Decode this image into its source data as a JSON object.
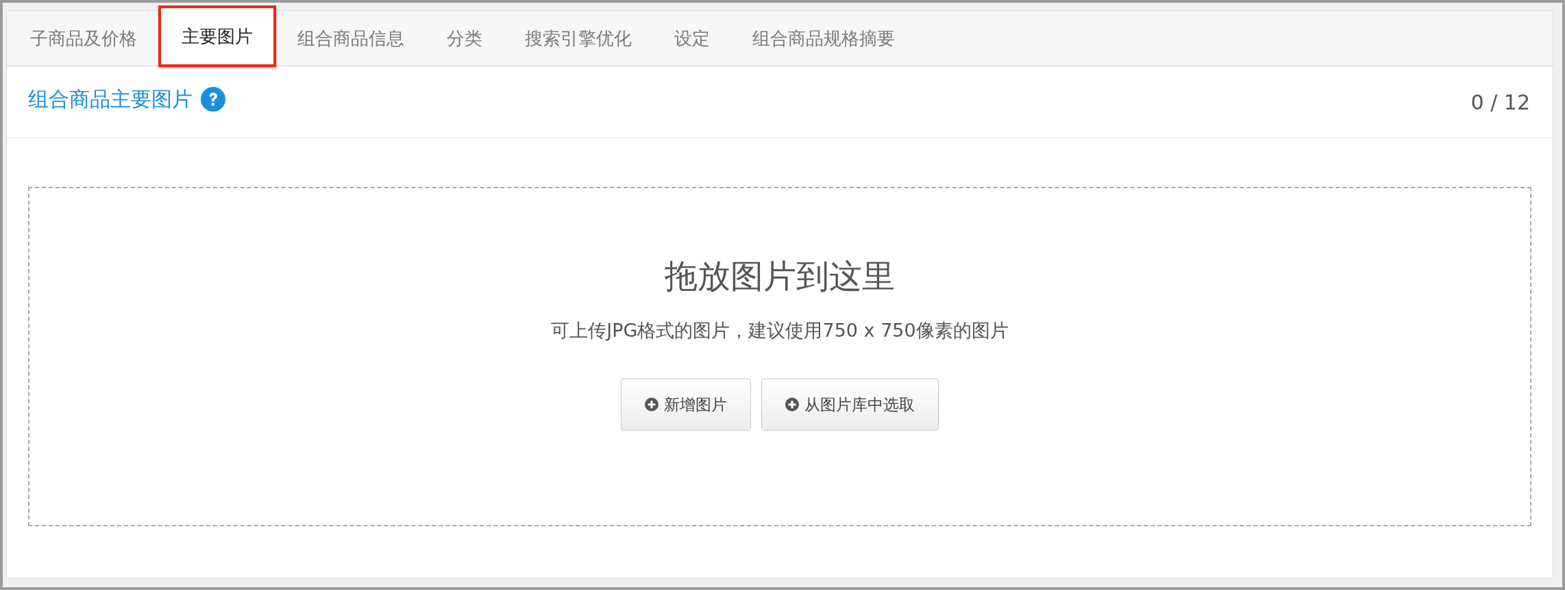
{
  "tabs": [
    {
      "label": "子商品及价格",
      "selected": false
    },
    {
      "label": "主要图片",
      "selected": true
    },
    {
      "label": "组合商品信息",
      "selected": false
    },
    {
      "label": "分类",
      "selected": false
    },
    {
      "label": "搜索引擎优化",
      "selected": false
    },
    {
      "label": "设定",
      "selected": false
    },
    {
      "label": "组合商品规格摘要",
      "selected": false
    }
  ],
  "section": {
    "title": "组合商品主要图片",
    "count": "0 / 12"
  },
  "dropzone": {
    "heading": "拖放图片到这里",
    "hint": "可上传JPG格式的图片，建议使用750 x 750像素的图片",
    "buttons": [
      "新增图片",
      "从图片库中选取"
    ]
  }
}
